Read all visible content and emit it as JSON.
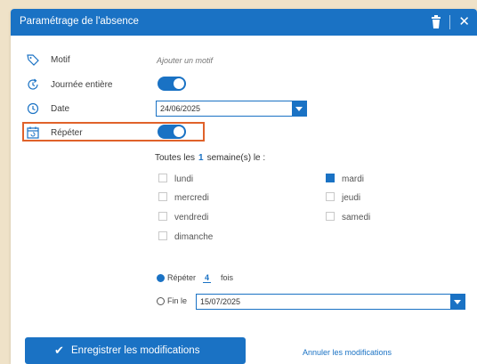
{
  "dialog": {
    "title": "Paramétrage de l'absence",
    "close_label": "✕"
  },
  "form": {
    "motif_label": "Motif",
    "motif_placeholder": "Ajouter un motif",
    "journee_label": "Journée entière",
    "journee_on": true,
    "date_label": "Date",
    "date_value": "24/06/2025",
    "repeter_label": "Répéter",
    "repeter_on": true
  },
  "recurrence": {
    "prefix": "Toutes les",
    "interval": "1",
    "suffix": "semaine(s) le :",
    "days": [
      {
        "label": "lundi",
        "checked": false
      },
      {
        "label": "mardi",
        "checked": true
      },
      {
        "label": "mercredi",
        "checked": false
      },
      {
        "label": "jeudi",
        "checked": false
      },
      {
        "label": "vendredi",
        "checked": false
      },
      {
        "label": "samedi",
        "checked": false
      },
      {
        "label": "dimanche",
        "checked": false
      }
    ],
    "repeat_label": "Répéter",
    "repeat_count": "4",
    "repeat_unit": "fois",
    "end_label": "Fin le",
    "end_date": "15/07/2025",
    "selected_mode": "repeat"
  },
  "footer": {
    "save_label": "Enregistrer les modifications",
    "cancel_label": "Annuler les modifications"
  },
  "colors": {
    "accent": "#1a72c4",
    "highlight": "#e0622a",
    "backdrop": "#efe2c8"
  }
}
